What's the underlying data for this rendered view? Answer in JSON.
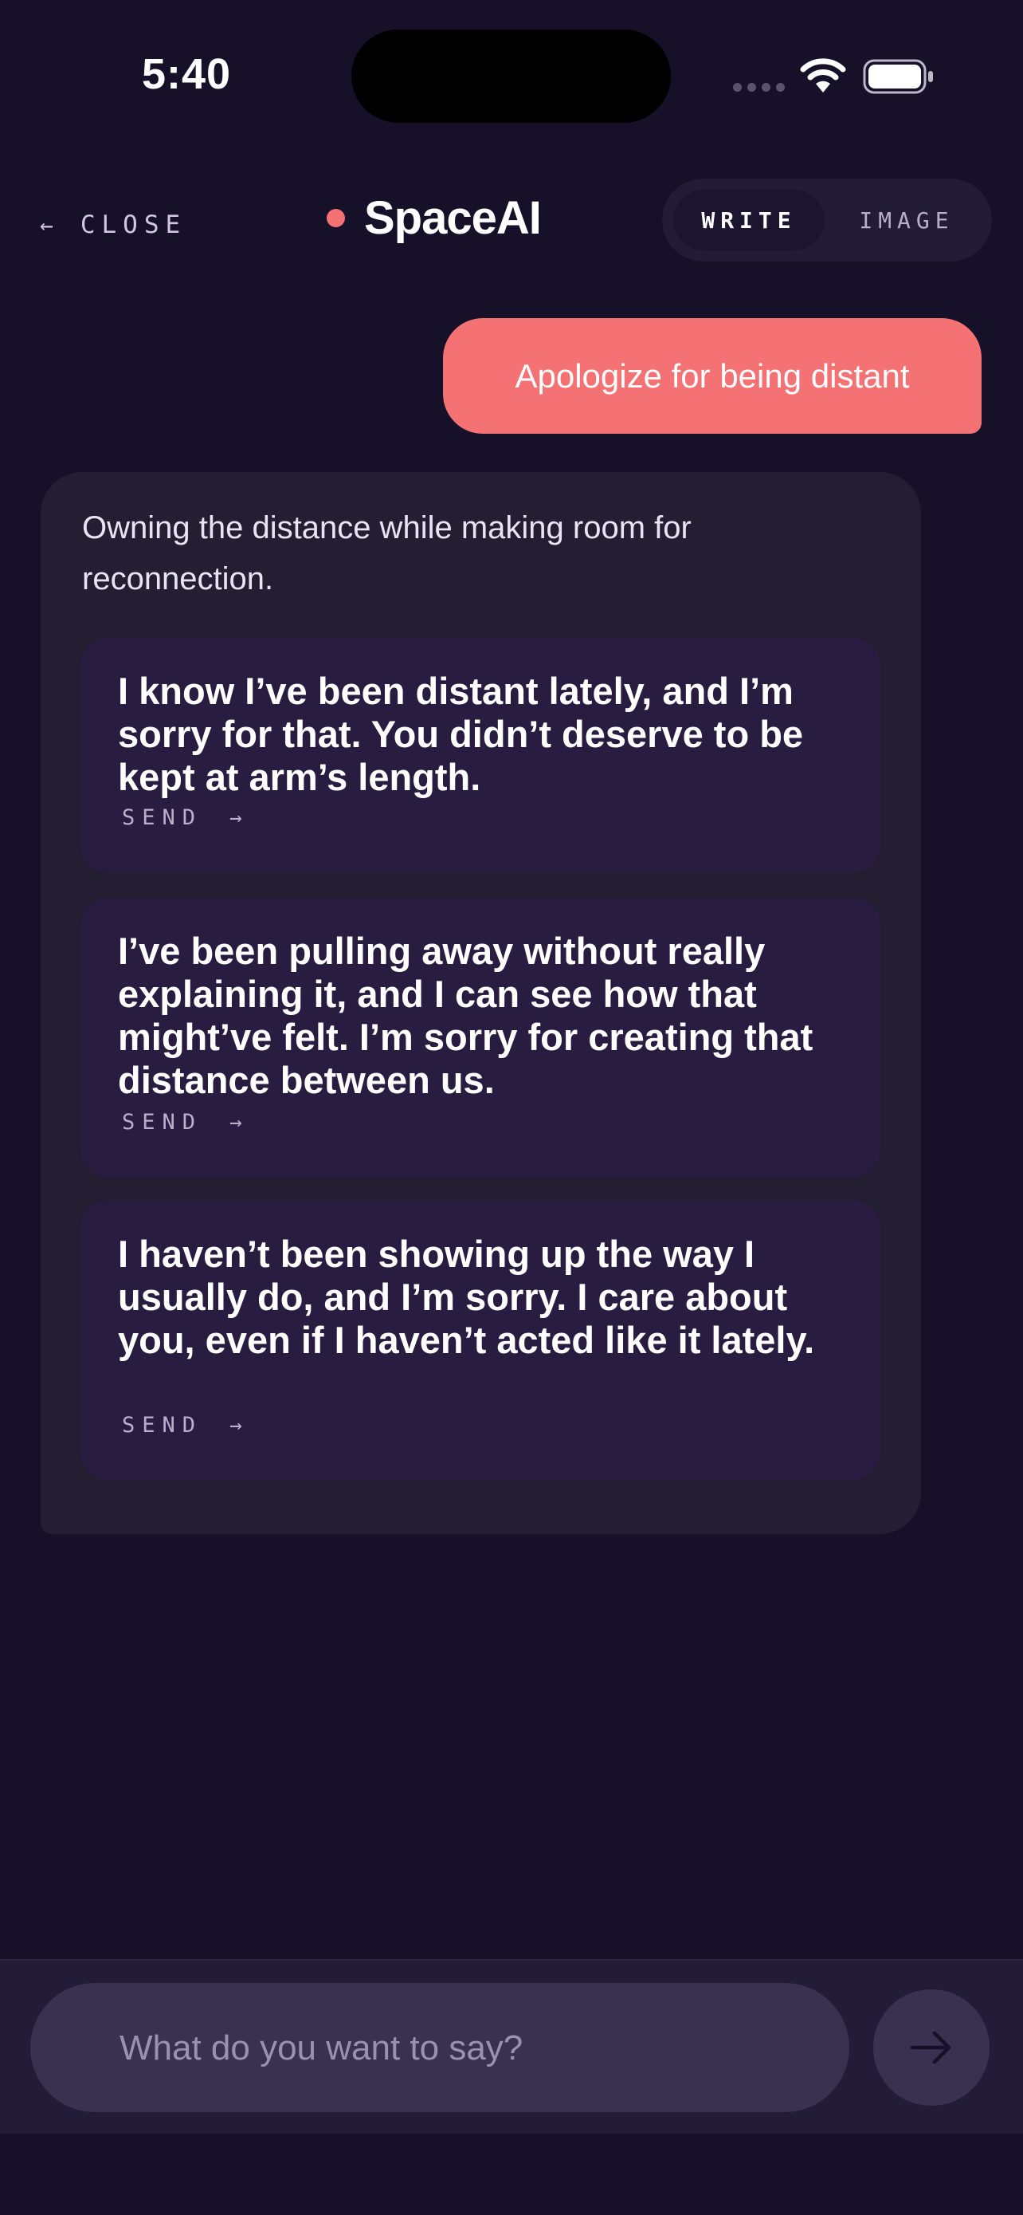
{
  "status_bar": {
    "time": "5:40",
    "icons": [
      "signal-icon",
      "wifi-icon",
      "battery-icon"
    ]
  },
  "header": {
    "close_arrow": "←",
    "close_label": "CLOSE",
    "brand_name": "SpaceAI",
    "modes": [
      {
        "label": "WRITE",
        "selected": true
      },
      {
        "label": "IMAGE",
        "selected": false
      }
    ]
  },
  "chat": {
    "user_message": "Apologize for being distant",
    "response_intro": "Owning the distance while making room for reconnection.",
    "options": [
      {
        "text": "I know I’ve been distant lately, and I’m sorry for that. You didn’t deserve to be kept at arm’s length.",
        "send_label": "SEND",
        "send_arrow": "→"
      },
      {
        "text": "I’ve been pulling away without really explaining it, and I can see how that might’ve felt. I’m sorry for creating that distance between us.",
        "send_label": "SEND",
        "send_arrow": "→"
      },
      {
        "text": "I haven’t been showing up the way I usually do, and I’m sorry. I care about you, even if I haven’t acted like it lately.",
        "send_label": "SEND",
        "send_arrow": "→"
      }
    ]
  },
  "composer": {
    "placeholder": "What do you want to say?",
    "value": "",
    "send_icon": "arrow-right-icon"
  },
  "colors": {
    "background": "#171029",
    "accent": "#f47174",
    "card": "#241e32",
    "option_card": "#281c40",
    "pill": "#3a3050"
  }
}
